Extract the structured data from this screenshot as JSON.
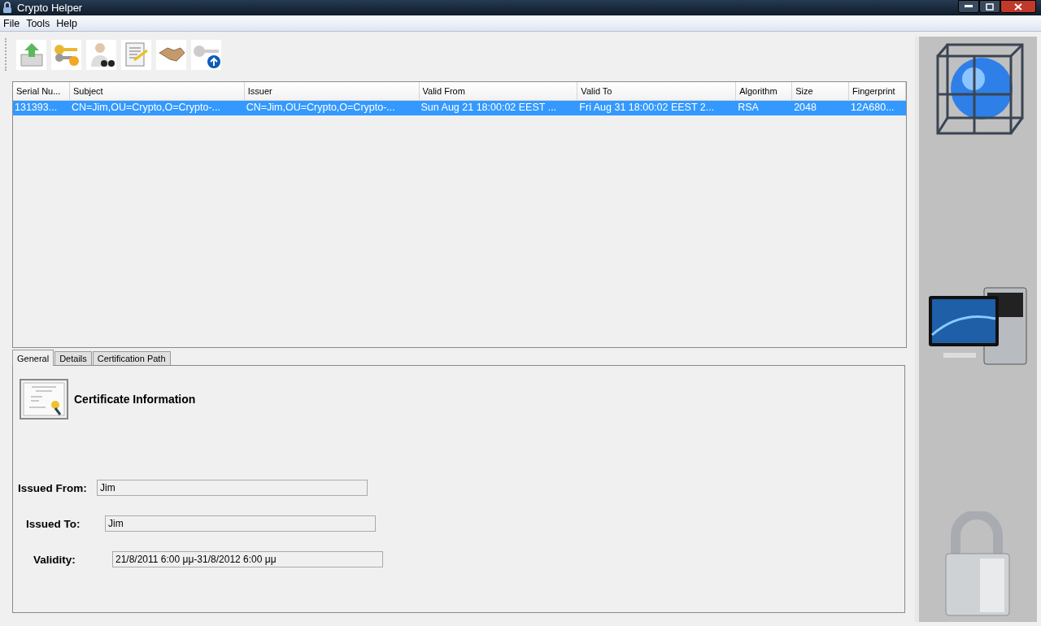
{
  "window": {
    "title": "Crypto Helper"
  },
  "menu": [
    "File",
    "Tools",
    "Help"
  ],
  "table": {
    "columns": [
      "Serial Nu...",
      "Subject",
      "Issuer",
      "Valid From",
      "Valid To",
      "Algorithm",
      "Size",
      "Fingerprint"
    ],
    "rows": [
      {
        "selected": true,
        "cells": [
          "131393...",
          "CN=Jim,OU=Crypto,O=Crypto-...",
          "CN=Jim,OU=Crypto,O=Crypto-...",
          "Sun Aug 21 18:00:02 EEST ...",
          "Fri Aug 31 18:00:02 EEST 2...",
          "RSA",
          "2048",
          "12A680..."
        ]
      }
    ]
  },
  "tabs": [
    {
      "label": "General",
      "selected": true
    },
    {
      "label": "Details",
      "selected": false
    },
    {
      "label": "Certification Path",
      "selected": false
    }
  ],
  "general": {
    "heading": "Certificate Information",
    "fields": [
      {
        "label": "Issued From:",
        "value": "Jim"
      },
      {
        "label": "Issued To:",
        "value": "Jim"
      },
      {
        "label": "Validity:",
        "value": "21/8/2011 6:00 μμ-31/8/2012 6:00 μμ"
      }
    ]
  }
}
